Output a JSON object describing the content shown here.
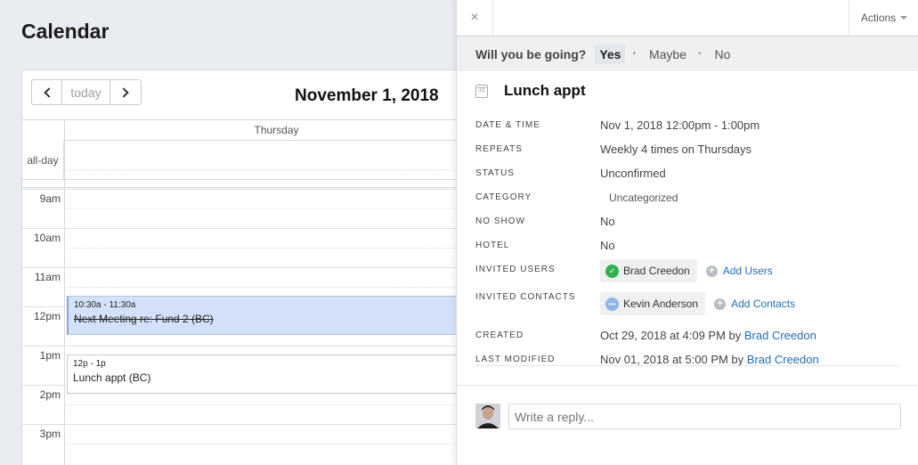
{
  "calendar": {
    "title": "Calendar",
    "today_label": "today",
    "date_heading": "November 1, 2018",
    "day_header": "Thursday",
    "allday_label": "all-day",
    "hours": [
      "9am",
      "10am",
      "11am",
      "12pm",
      "1pm",
      "2pm",
      "3pm"
    ],
    "events": [
      {
        "time": "10:30a - 11:30a",
        "title": "Next Meeting re: Fund 2 (BC)"
      },
      {
        "time": "12p - 1p",
        "title": "Lunch appt (BC)"
      }
    ]
  },
  "panel": {
    "close_label": "×",
    "actions_label": "Actions",
    "rsvp": {
      "question": "Will you be going?",
      "options": [
        "Yes",
        "Maybe",
        "No"
      ],
      "selected": "Yes"
    },
    "event_title": "Lunch appt",
    "calendar_icon_text": "31",
    "fields": {
      "date_time": {
        "label": "Date & Time",
        "value": "Nov 1, 2018 12:00pm - 1:00pm"
      },
      "repeats": {
        "label": "Repeats",
        "value": "Weekly 4 times on Thursdays"
      },
      "status": {
        "label": "Status",
        "value": "Unconfirmed"
      },
      "category": {
        "label": "Category",
        "value": "Uncategorized"
      },
      "no_show": {
        "label": "No Show",
        "value": "No"
      },
      "hotel": {
        "label": "Hotel",
        "value": "No"
      },
      "invited_users": {
        "label": "Invited Users",
        "chip": "Brad Creedon",
        "add": "Add Users"
      },
      "invited_contacts": {
        "label": "Invited Contacts",
        "chip": "Kevin Anderson",
        "add": "Add Contacts"
      },
      "created": {
        "label": "Created",
        "value": "Oct 29, 2018 at 4:09 PM by",
        "by": "Brad Creedon"
      },
      "last_modified": {
        "label": "Last Modified",
        "value": "Nov 01, 2018 at 5:00 PM by",
        "by": "Brad Creedon"
      }
    },
    "reply_placeholder": "Write a reply..."
  },
  "colors": {
    "accent_link": "#1f6fb6",
    "event_selected_bg": "#d3e2fa",
    "status_green": "#2fb14c"
  }
}
